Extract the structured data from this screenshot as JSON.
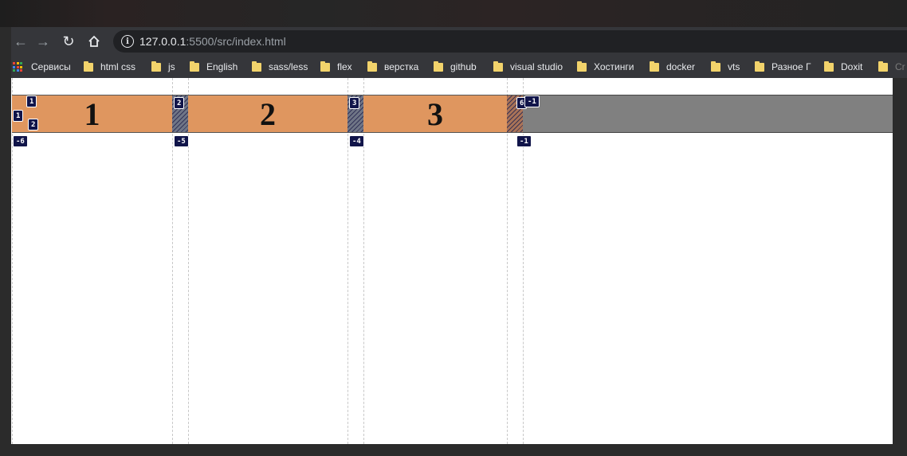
{
  "browser": {
    "url_host": "127.0.0.1",
    "url_rest": ":5500/src/index.html"
  },
  "bookmarks": {
    "apps_label": "Сервисы",
    "items": [
      "html css",
      "js",
      "English",
      "sass/less",
      "flex",
      "верстка",
      "github",
      "visual studio",
      "Хостинги",
      "docker",
      "vts",
      "Разное Г",
      "Doxit",
      "Cr"
    ]
  },
  "grid": {
    "items": [
      "1",
      "2",
      "3"
    ],
    "line_numbers_top": [
      "1",
      "2",
      "3",
      "6",
      "-1"
    ],
    "line_numbers_bottom": [
      "-6",
      "-5",
      "-4",
      "-1"
    ],
    "row_numbers": [
      "1",
      "2"
    ],
    "row_number_left": "1"
  },
  "colors": {
    "item": "#df965f",
    "container": "#808080",
    "badge": "#11154a"
  }
}
